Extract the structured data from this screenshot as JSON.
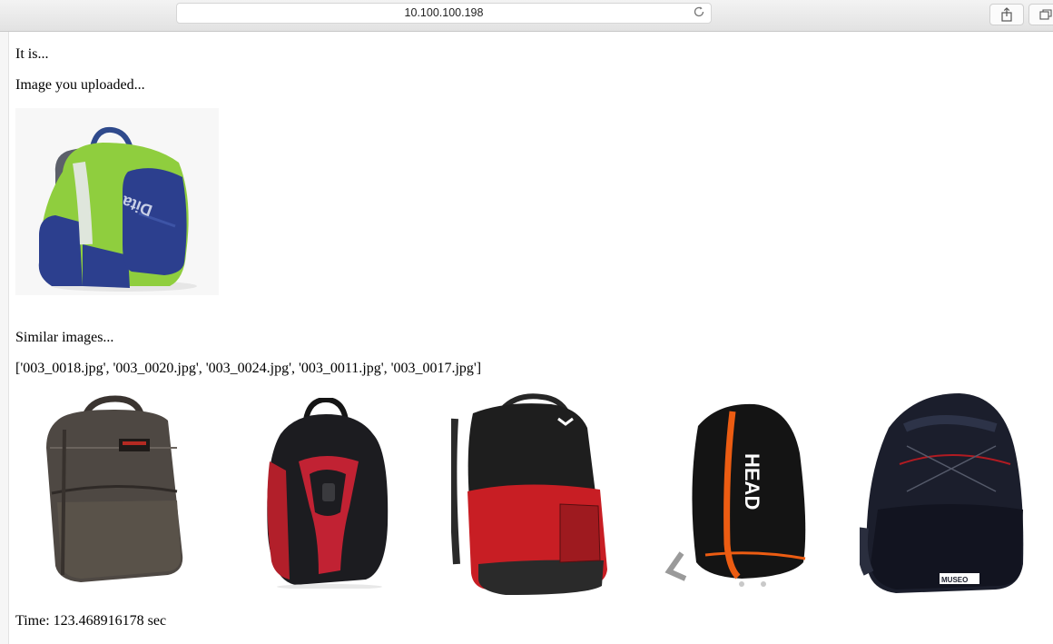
{
  "browser": {
    "url": "10.100.100.198"
  },
  "page": {
    "heading": "It is...",
    "uploaded_label": "Image you uploaded...",
    "similar_label": "Similar images...",
    "file_list": "['003_0018.jpg', '003_0020.jpg', '003_0024.jpg', '003_0011.jpg', '003_0017.jpg']",
    "time": "Time: 123.468916178 sec"
  },
  "uploaded_image": {
    "subject": "green-blue-backpack",
    "brand_text": "Dita"
  },
  "similar_images": [
    {
      "subject": "brown-backpack"
    },
    {
      "subject": "black-red-backpack"
    },
    {
      "subject": "red-black-backpack"
    },
    {
      "subject": "black-head-backpack",
      "brand_text": "HEAD"
    },
    {
      "subject": "navy-backpack",
      "brand_text": "MUSEO"
    }
  ]
}
